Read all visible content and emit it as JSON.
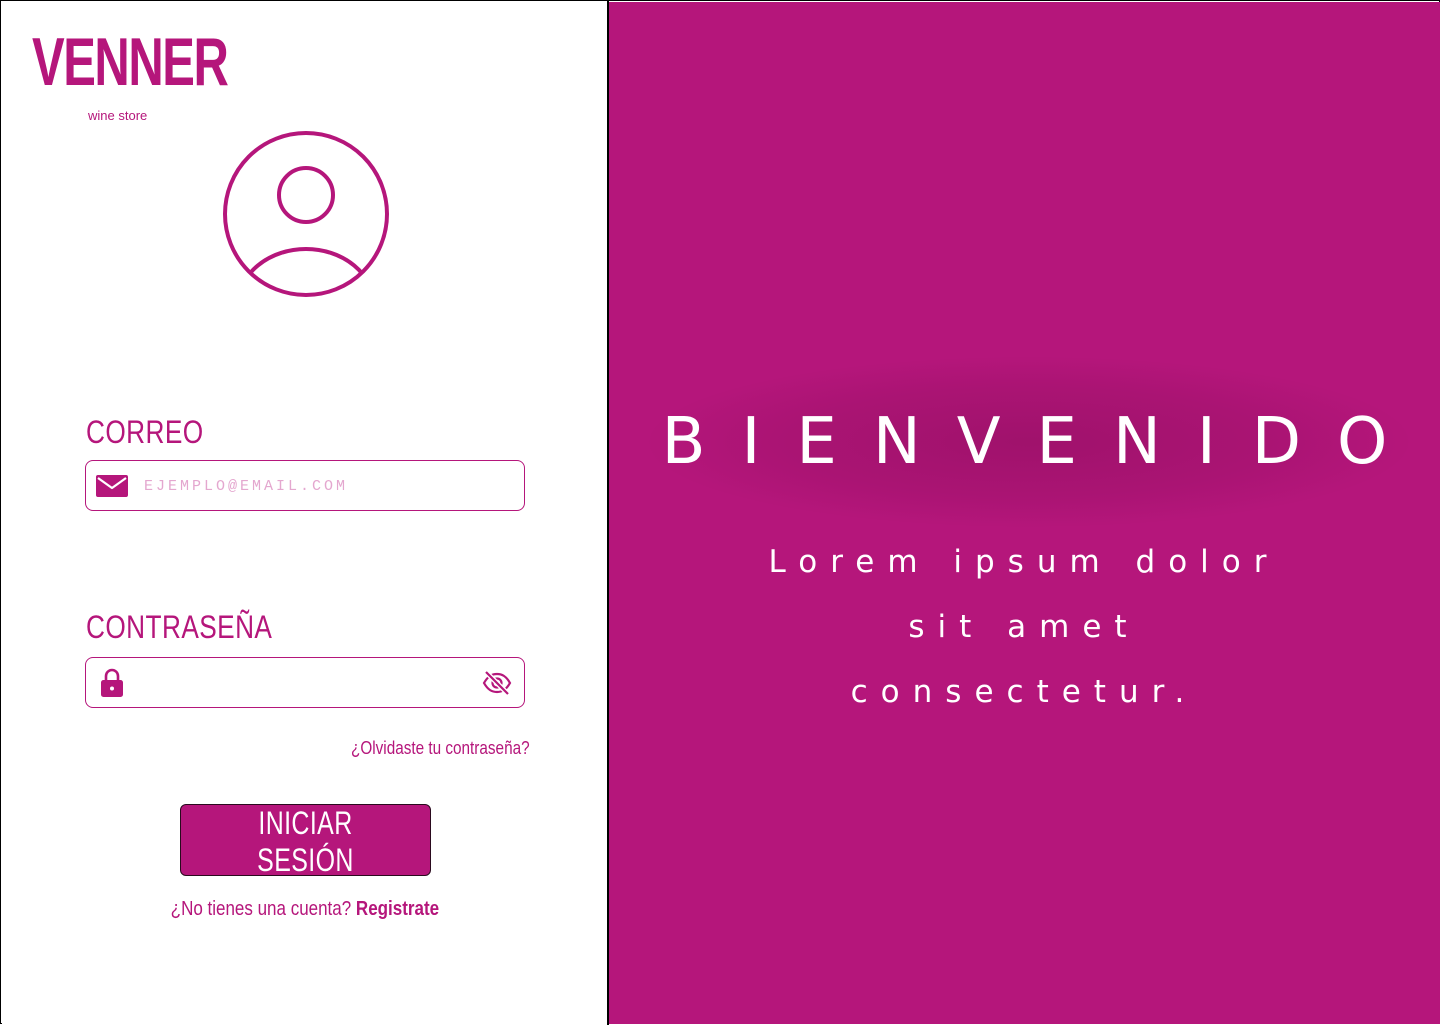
{
  "brand": {
    "name": "VENNER",
    "tagline": "wine store"
  },
  "colors": {
    "accent": "#b5167b",
    "accent_light": "#e4a7cf",
    "background": "#ffffff",
    "text_on_accent": "#ffffff"
  },
  "login_form": {
    "email_label": "CORREO",
    "email_placeholder": "EJEMPLO@EMAIL.COM",
    "email_value": "",
    "password_label": "CONTRASEÑA",
    "password_value": "",
    "forgot_password": "¿Olvidaste tu contraseña?",
    "submit_label": "INICIAR SESIÓN",
    "signup_prompt": "¿No tienes una cuenta?",
    "signup_link": "Registrate"
  },
  "icons": {
    "avatar": "user-circle-icon",
    "email": "envelope-icon",
    "password": "lock-icon",
    "toggle_visibility": "eye-off-icon"
  },
  "welcome": {
    "title": "BIENVENIDO",
    "message": "Lorem ipsum dolor sit amet consectetur."
  }
}
